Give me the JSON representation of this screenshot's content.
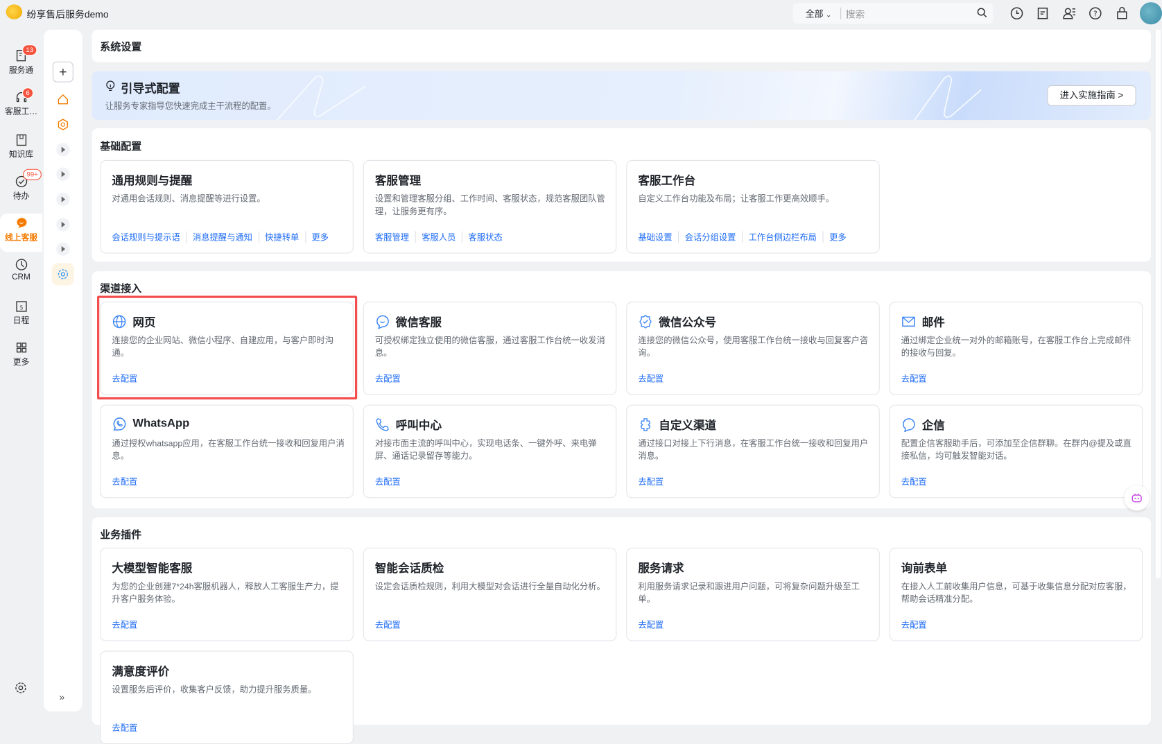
{
  "app": {
    "title": "纷享售后服务demo"
  },
  "search": {
    "scope": "全部",
    "placeholder": "搜索"
  },
  "rail": {
    "items": [
      {
        "label": "服务通",
        "badge": "13"
      },
      {
        "label": "客服工…",
        "badge": "6"
      },
      {
        "label": "知识库",
        "badge": ""
      },
      {
        "label": "待办",
        "badge": "99+"
      },
      {
        "label": "线上客服",
        "badge": ""
      },
      {
        "label": "CRM",
        "badge": ""
      },
      {
        "label": "日程",
        "badge": ""
      },
      {
        "label": "更多",
        "badge": ""
      }
    ]
  },
  "header": {
    "title": "系统设置"
  },
  "banner": {
    "title": "引导式配置",
    "subtitle": "让服务专家指导您快速完成主干流程的配置。",
    "button": "进入实施指南 >"
  },
  "basic": {
    "title": "基础配置",
    "cards": [
      {
        "title": "通用规则与提醒",
        "desc": "对通用会话规则、消息提醒等进行设置。",
        "links": [
          "会话规则与提示语",
          "消息提醒与通知",
          "快捷转单",
          "更多"
        ]
      },
      {
        "title": "客服管理",
        "desc": "设置和管理客服分组、工作时间、客服状态，规范客服团队管理，让服务更有序。",
        "links": [
          "客服管理",
          "客服人员",
          "客服状态"
        ]
      },
      {
        "title": "客服工作台",
        "desc": "自定义工作台功能及布局；让客服工作更高效顺手。",
        "links": [
          "基础设置",
          "会话分组设置",
          "工作台侧边栏布局",
          "更多"
        ]
      }
    ]
  },
  "channels": {
    "title": "渠道接入",
    "cards": [
      {
        "title": "网页",
        "desc": "连接您的企业网站、微信小程序、自建应用，与客户即时沟通。",
        "link": "去配置"
      },
      {
        "title": "微信客服",
        "desc": "可授权绑定独立使用的微信客服，通过客服工作台统一收发消息。",
        "link": "去配置"
      },
      {
        "title": "微信公众号",
        "desc": "连接您的微信公众号，使用客服工作台统一接收与回复客户咨询。",
        "link": "去配置"
      },
      {
        "title": "邮件",
        "desc": "通过绑定企业统一对外的邮箱账号，在客服工作台上完成邮件的接收与回复。",
        "link": "去配置"
      },
      {
        "title": "WhatsApp",
        "desc": "通过授权whatsapp应用，在客服工作台统一接收和回复用户消息。",
        "link": "去配置"
      },
      {
        "title": "呼叫中心",
        "desc": "对接市面主流的呼叫中心，实现电话条、一键外呼、来电弹屏、通话记录留存等能力。",
        "link": "去配置"
      },
      {
        "title": "自定义渠道",
        "desc": "通过接口对接上下行消息，在客服工作台统一接收和回复用户消息。",
        "link": "去配置"
      },
      {
        "title": "企信",
        "desc": "配置企信客服助手后，可添加至企信群聊。在群内@提及或直接私信，均可触发智能对话。",
        "link": "去配置"
      }
    ]
  },
  "plugins": {
    "title": "业务插件",
    "cards": [
      {
        "title": "大模型智能客服",
        "desc": "为您的企业创建7*24h客服机器人，释放人工客服生产力，提升客户服务体验。",
        "link": "去配置"
      },
      {
        "title": "智能会话质检",
        "desc": "设定会话质检规则，利用大模型对会话进行全量自动化分析。",
        "link": "去配置"
      },
      {
        "title": "服务请求",
        "desc": "利用服务请求记录和跟进用户问题，可将复杂问题升级至工单。",
        "link": "去配置"
      },
      {
        "title": "询前表单",
        "desc": "在接入人工前收集用户信息，可基于收集信息分配对应客服，帮助会话精准分配。",
        "link": "去配置"
      },
      {
        "title": "满意度评价",
        "desc": "设置服务后评价，收集客户反馈，助力提升服务质量。",
        "link": "去配置"
      }
    ]
  },
  "colors": {
    "accent": "#1f6cf5",
    "active": "#f57a00",
    "highlight": "#f34d4d"
  }
}
